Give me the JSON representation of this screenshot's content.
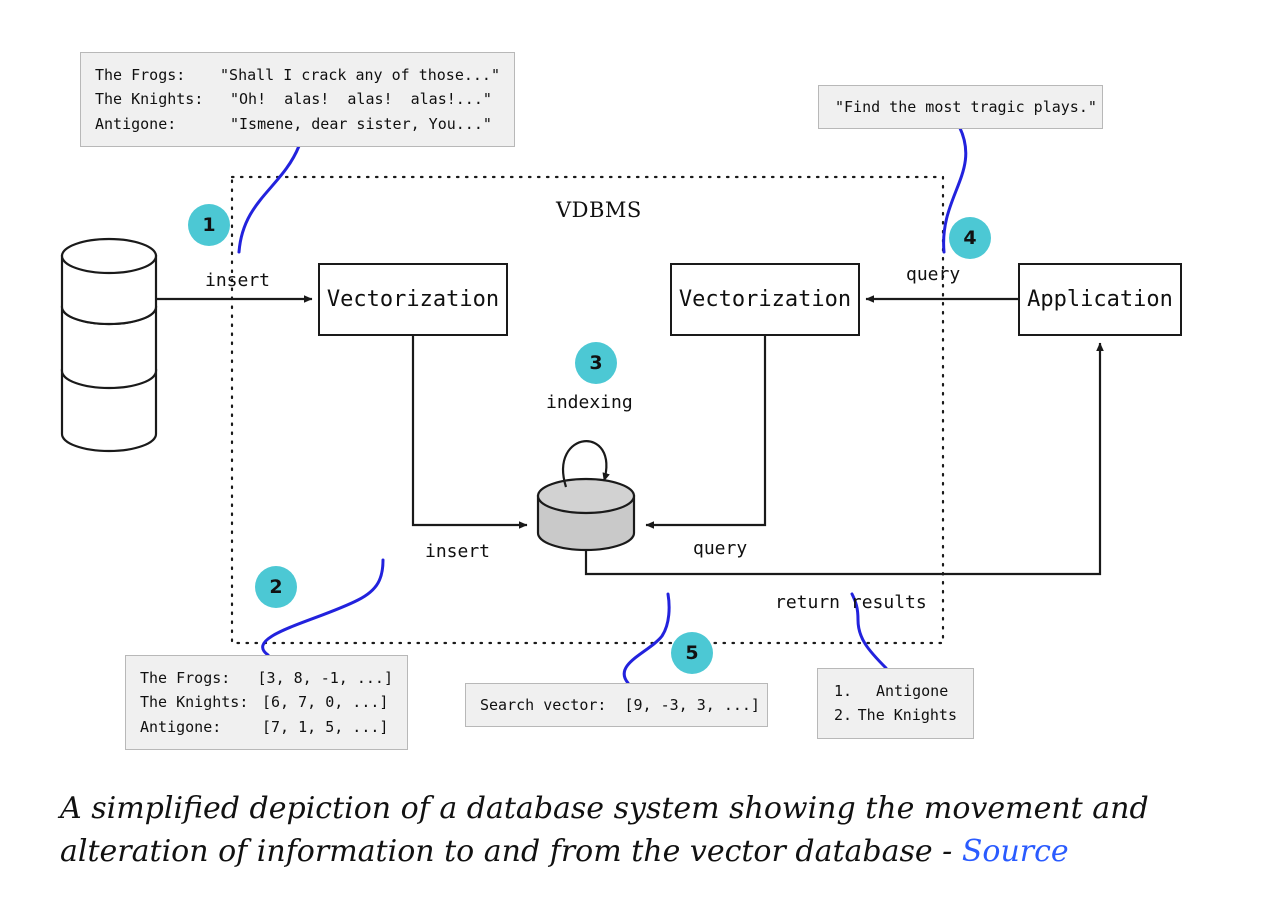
{
  "diagram": {
    "system_label": "VDBMS",
    "source_documents": {
      "rows": [
        {
          "key": "The Frogs:",
          "value": "\"Shall I crack any of those...\""
        },
        {
          "key": "The Knights:",
          "value": "\"Oh!  alas!  alas!  alas!...\""
        },
        {
          "key": "Antigone:",
          "value": "\"Ismene, dear sister, You...\""
        }
      ]
    },
    "vector_documents": {
      "rows": [
        {
          "key": "The Frogs:",
          "value": "[3, 8, -1, ...]"
        },
        {
          "key": "The Knights:",
          "value": "[6, 7, 0, ...]"
        },
        {
          "key": "Antigone:",
          "value": "[7, 1, 5, ...]"
        }
      ]
    },
    "user_query": "\"Find the most tragic plays.\"",
    "search_vector": "Search vector:  [9, -3, 3, ...]",
    "results": {
      "rows": [
        {
          "key": "1.",
          "value": "Antigone"
        },
        {
          "key": "2.",
          "value": "The Knights"
        }
      ]
    },
    "nodes": {
      "vectorization_insert": "Vectorization",
      "vectorization_query": "Vectorization",
      "application": "Application"
    },
    "edge_labels": {
      "insert_source": "insert",
      "insert_index": "insert",
      "indexing": "indexing",
      "query_app": "query",
      "query_index": "query",
      "return_results": "return results"
    },
    "badges": [
      {
        "id": 1,
        "label": "1"
      },
      {
        "id": 2,
        "label": "2"
      },
      {
        "id": 3,
        "label": "3"
      },
      {
        "id": 4,
        "label": "4"
      },
      {
        "id": 5,
        "label": "5"
      }
    ],
    "colors": {
      "badge": "#4cc8d4",
      "pointer_line": "#2222dd",
      "cylinder_fill": "#c9c9c9",
      "textbox_fill": "#f0f0f0",
      "link": "#2a5bff"
    }
  },
  "caption": {
    "text": "A simplified depiction of a database system showing the movement and alteration of information to and from the vector database - ",
    "link_label": "Source"
  }
}
